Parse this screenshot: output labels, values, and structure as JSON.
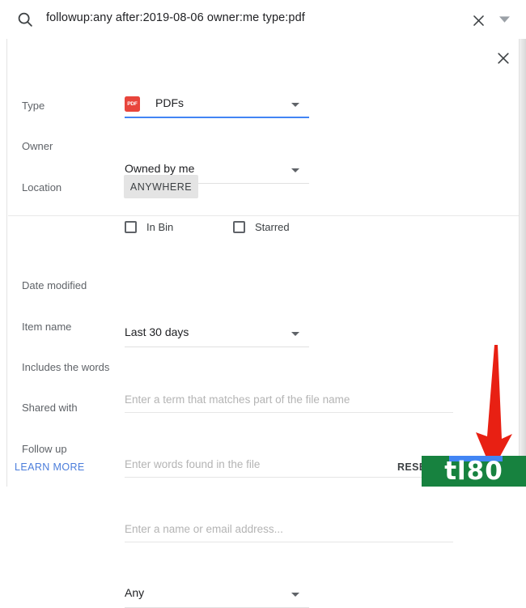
{
  "search": {
    "query": "followup:any after:2019-08-06 owner:me type:pdf",
    "icon": "search-icon",
    "clear_icon": "close-icon",
    "expand_icon": "chevron-down-icon"
  },
  "dialog": {
    "close_icon": "close-icon",
    "rows": {
      "type": {
        "label": "Type",
        "value": "PDFs",
        "file_icon_label": "PDF",
        "file_icon_color": "#e8453c",
        "focused": true,
        "arrow_icon": "chevron-down-icon"
      },
      "owner": {
        "label": "Owner",
        "value": "Owned by me",
        "arrow_icon": "chevron-down-icon"
      },
      "location": {
        "label": "Location",
        "button_label": "ANYWHERE",
        "checkboxes": [
          {
            "label": "In Bin",
            "checked": false
          },
          {
            "label": "Starred",
            "checked": false
          }
        ]
      },
      "date_modified": {
        "label": "Date modified",
        "value": "Last 30 days",
        "arrow_icon": "chevron-down-icon"
      },
      "item_name": {
        "label": "Item name",
        "value": "",
        "placeholder": "Enter a term that matches part of the file name"
      },
      "includes_words": {
        "label": "Includes the words",
        "value": "",
        "placeholder": "Enter words found in the file"
      },
      "shared_with": {
        "label": "Shared with",
        "value": "",
        "placeholder": "Enter a name or email address..."
      },
      "follow_up": {
        "label": "Follow up",
        "value": "Any",
        "arrow_icon": "chevron-down-icon"
      }
    },
    "footer": {
      "learn_more": "LEARN MORE",
      "learn_more_color": "#4b7ddb",
      "reset": "RESET"
    }
  },
  "annotations": {
    "arrow_color": "#e82013",
    "arrow_name": "red-pointer-arrow"
  },
  "watermark": {
    "text": "tl80",
    "background": "#17823f",
    "bar_color": "#4285f4"
  }
}
